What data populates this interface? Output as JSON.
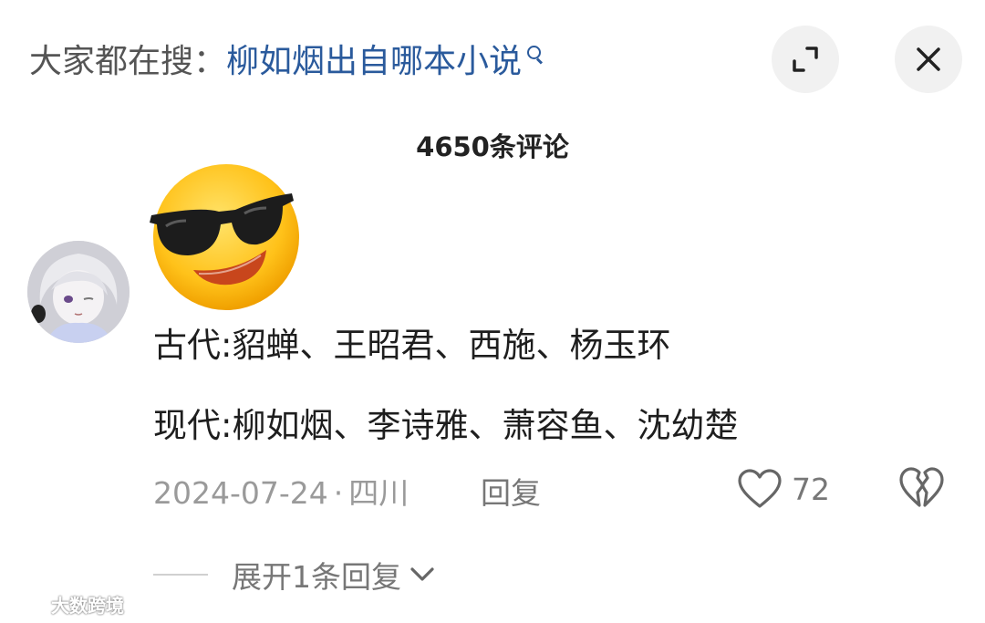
{
  "search_hint": {
    "prefix": "大家都在搜：",
    "query": "柳如烟出自哪本小说"
  },
  "header": {
    "comment_count": "4650条评论"
  },
  "comment": {
    "emoji_icon": "sunglasses-face-icon",
    "lines": [
      "古代:貂蝉、王昭君、西施、杨玉环",
      "现代:柳如烟、李诗雅、萧容鱼、沈幼楚"
    ],
    "date": "2024-07-24",
    "separator": "·",
    "location": "四川",
    "reply_label": "回复",
    "like_count": "72"
  },
  "replies": {
    "expand_label": "展开1条回复"
  },
  "watermark": {
    "text": "大数跨境"
  },
  "colors": {
    "link": "#2a5a9c",
    "muted": "#9a9a9a",
    "button_bg": "#f1f1f1"
  }
}
